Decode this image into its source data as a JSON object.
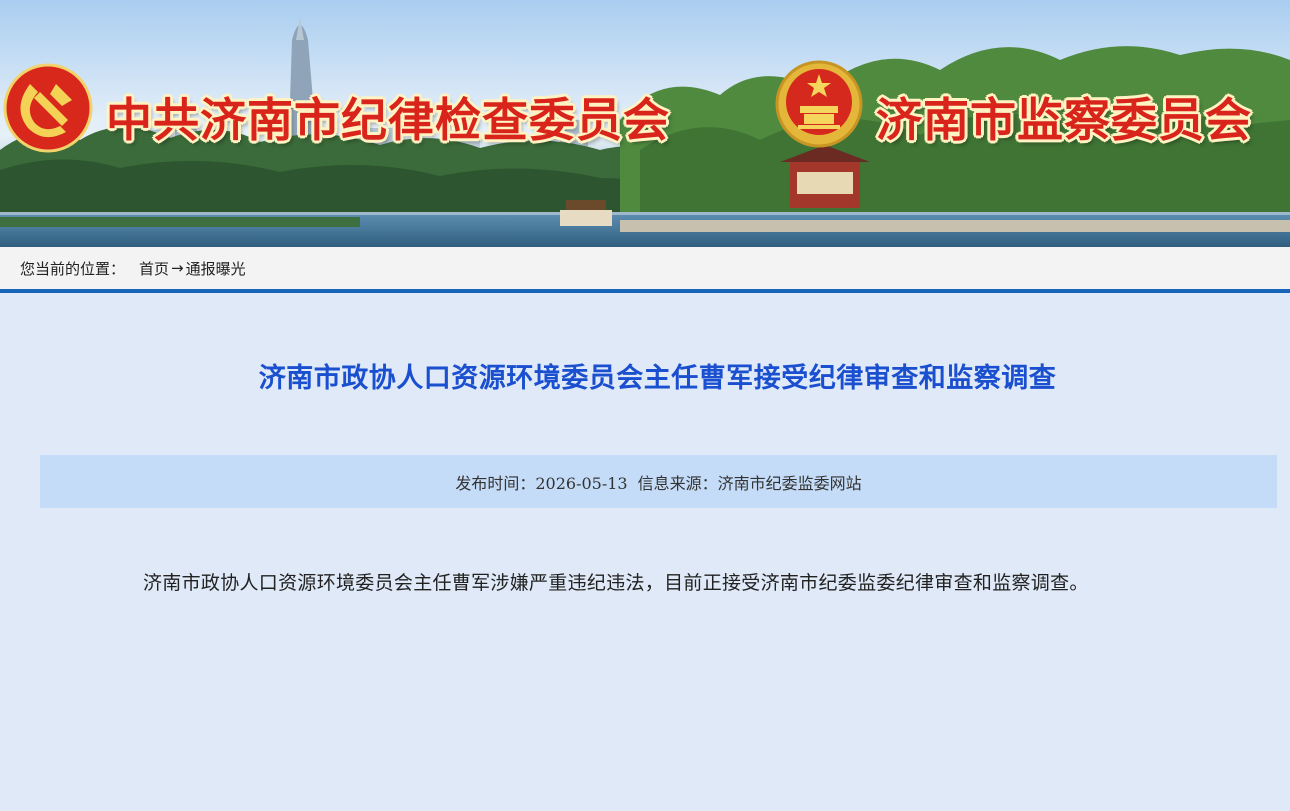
{
  "banner": {
    "left_title": "中共济南市纪律检查委员会",
    "right_title": "济南市监察委员会",
    "left_emblem": "party-emblem",
    "right_emblem": "national-emblem"
  },
  "breadcrumb": {
    "label": "您当前的位置：",
    "items": [
      "首页",
      "通报曝光"
    ],
    "separator": "→"
  },
  "article": {
    "title": "济南市政协人口资源环境委员会主任曹军接受纪律审查和监察调查",
    "publish_label": "发布时间：",
    "publish_date": "2026-05-13",
    "source_label": "信息来源：",
    "source": "济南市纪委监委网站",
    "body": "济南市政协人口资源环境委员会主任曹军涉嫌严重违纪违法，目前正接受济南市纪委监委纪律审查和监察调查。"
  },
  "colors": {
    "title_blue": "#1a4fcf",
    "breadcrumb_rule": "#1665b8",
    "meta_bar": "#c4dcf7",
    "page_background": "#dfe9f7",
    "banner_text_red": "#d9241b"
  }
}
